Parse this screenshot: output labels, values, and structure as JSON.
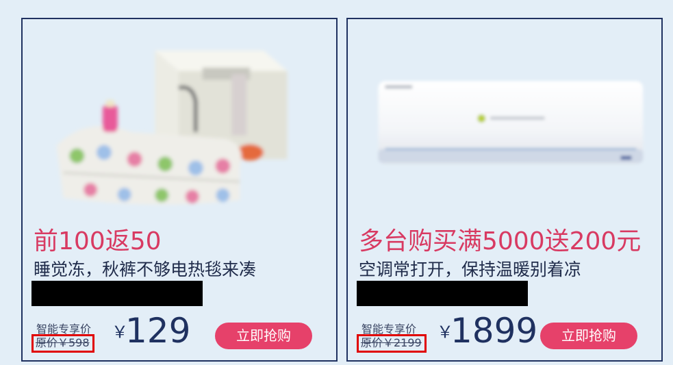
{
  "products": [
    {
      "image_icon": "electric-blanket-image",
      "promo_title": "前100返50",
      "subtitle": "睡觉冻，秋裤不够电热毯来凑",
      "smart_price_label": "智能专享价",
      "original_price": "原价￥598",
      "currency_symbol": "￥",
      "price": "129",
      "buy_button": "立即抢购"
    },
    {
      "image_icon": "air-conditioner-image",
      "promo_title": "多台购买满5000送200元",
      "subtitle": "空调常打开，保持温暖别着凉",
      "smart_price_label": "智能专享价",
      "original_price": "原价￥2199",
      "currency_symbol": "￥",
      "price": "1899",
      "buy_button": "立即抢购"
    }
  ],
  "colors": {
    "background": "#e3eef7",
    "card_border": "#1f3160",
    "promo_red": "#d83a62",
    "button_pink": "#e6416a",
    "price_navy": "#1f3160",
    "highlight_box": "#e00000"
  }
}
